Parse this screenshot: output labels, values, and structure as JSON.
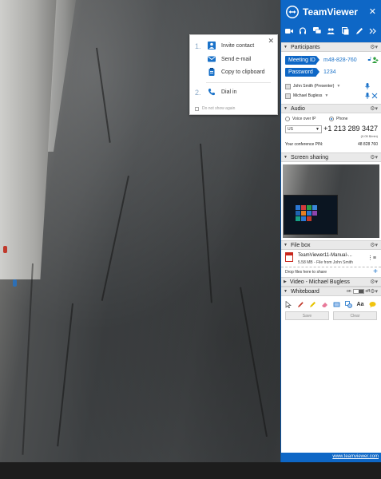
{
  "invite_popup": {
    "step1": "1.",
    "step2": "2.",
    "invite_contact": "Invite contact",
    "send_email": "Send e-mail",
    "copy_clipboard": "Copy to clipboard",
    "dial_in": "Dial in",
    "dont_show": "Do not show again",
    "close": "✕"
  },
  "teamviewer": {
    "brand": "TeamViewer",
    "close": "✕"
  },
  "participants": {
    "title": "Participants",
    "meeting_id_label": "Meeting ID",
    "meeting_id": "m48-828-760",
    "password_label": "Password",
    "password": "1234",
    "people": [
      {
        "name": "John Smith (Presenter)"
      },
      {
        "name": "Michael Bugless"
      }
    ]
  },
  "audio": {
    "title": "Audio",
    "voip_label": "Voice over IP",
    "phone_label": "Phone",
    "selected": "phone",
    "country": "US",
    "phone_number": "+1 213 289 3427",
    "rate": "(0.05 $/min)",
    "pin_label": "Your conference PIN:",
    "pin": "48 828 760"
  },
  "screen_sharing": {
    "title": "Screen sharing"
  },
  "file_box": {
    "title": "File box",
    "file_name": "TeamViewer11-Manual-...",
    "file_meta": "5.58 MB - File from John Smith",
    "drop_text": "Drop files here to share"
  },
  "video": {
    "title": "Video - Michael Bugless"
  },
  "whiteboard": {
    "title": "Whiteboard",
    "toggle_on": "on",
    "toggle_off": "off",
    "save": "Save",
    "clear": "Clear"
  },
  "footer": {
    "url": "www.teamviewer.com"
  },
  "colors": {
    "accent": "#0e67c6",
    "link": "#1a72c9"
  }
}
